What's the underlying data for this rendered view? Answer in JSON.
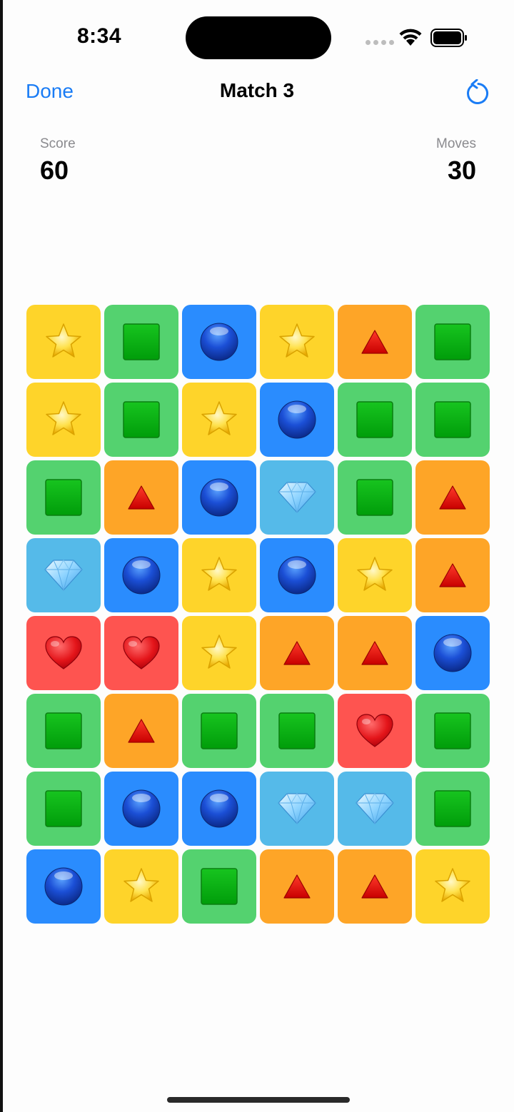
{
  "status_bar": {
    "time": "8:34"
  },
  "nav": {
    "done_label": "Done",
    "title": "Match 3",
    "reset_icon": "arrow-counterclockwise-icon"
  },
  "stats": {
    "score_label": "Score",
    "score_value": "60",
    "moves_label": "Moves",
    "moves_value": "30"
  },
  "tile_colors": {
    "star": "#fed42a",
    "square": "#54d26f",
    "circle": "#2a8cfe",
    "triangle": "#fea527",
    "diamond": "#55bae9",
    "heart": "#fe5450"
  },
  "board": {
    "rows": [
      [
        "star",
        "square",
        "circle",
        "star",
        "triangle",
        "square"
      ],
      [
        "star",
        "square",
        "star",
        "circle",
        "square",
        "square"
      ],
      [
        "square",
        "triangle",
        "circle",
        "diamond",
        "square",
        "triangle"
      ],
      [
        "diamond",
        "circle",
        "star",
        "circle",
        "star",
        "triangle"
      ],
      [
        "heart",
        "heart",
        "star",
        "triangle",
        "triangle",
        "circle"
      ],
      [
        "square",
        "triangle",
        "square",
        "square",
        "heart",
        "square"
      ],
      [
        "square",
        "circle",
        "circle",
        "diamond",
        "diamond",
        "square"
      ],
      [
        "circle",
        "star",
        "square",
        "triangle",
        "triangle",
        "star"
      ]
    ]
  }
}
